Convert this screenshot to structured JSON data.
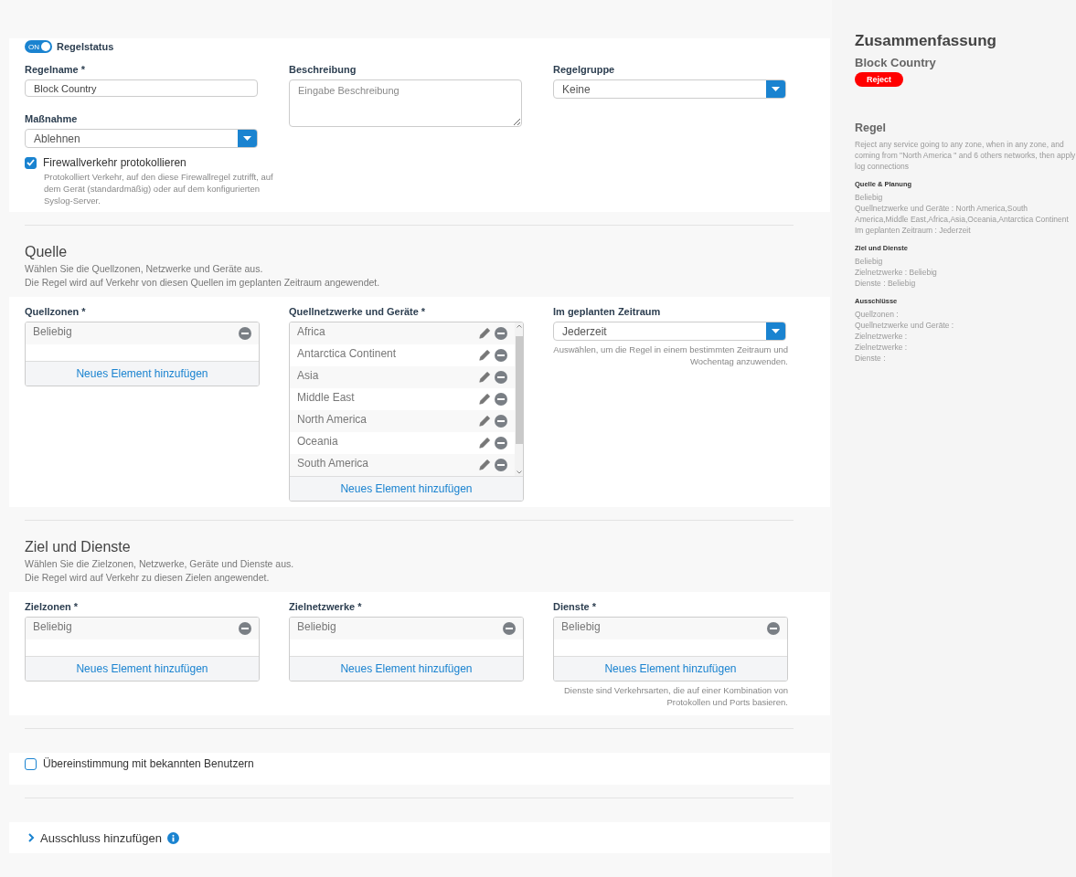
{
  "rule_status": {
    "toggle_text": "ON",
    "on": true,
    "label": "Regelstatus"
  },
  "rule_name": {
    "label": "Regelname *",
    "value": "Block Country"
  },
  "description": {
    "label": "Beschreibung",
    "placeholder": "Eingabe Beschreibung"
  },
  "rule_group": {
    "label": "Regelgruppe",
    "value": "Keine"
  },
  "action": {
    "label": "Maßnahme",
    "value": "Ablehnen"
  },
  "log_traffic": {
    "label": "Firewallverkehr protokollieren",
    "checked": true,
    "hint": "Protokolliert Verkehr, auf den diese Firewallregel zutrifft, auf dem Gerät (standardmäßig) oder auf dem konfigurierten Syslog-Server."
  },
  "source": {
    "title": "Quelle",
    "subtitle_lines": [
      "Wählen Sie die Quellzonen, Netzwerke und Geräte aus.",
      "Die Regel wird auf Verkehr von diesen Quellen im geplanten Zeitraum angewendet."
    ],
    "zones": {
      "label": "Quellzonen *",
      "items": [
        "Beliebig"
      ],
      "add": "Neues Element hinzufügen"
    },
    "networks": {
      "label": "Quellnetzwerke und Geräte *",
      "items": [
        "Africa",
        "Antarctica Continent",
        "Asia",
        "Middle East",
        "North America",
        "Oceania",
        "South America"
      ],
      "add": "Neues Element hinzufügen"
    },
    "schedule": {
      "label": "Im geplanten Zeitraum",
      "value": "Jederzeit",
      "hint": "Auswählen, um die Regel in einem bestimmten Zeitraum und Wochentag anzuwenden."
    }
  },
  "destination": {
    "title": "Ziel und Dienste",
    "subtitle_lines": [
      "Wählen Sie die Zielzonen, Netzwerke, Geräte und Dienste aus.",
      "Die Regel wird auf Verkehr zu diesen Zielen angewendet."
    ],
    "zones": {
      "label": "Zielzonen *",
      "items": [
        "Beliebig"
      ],
      "add": "Neues Element hinzufügen"
    },
    "networks": {
      "label": "Zielnetzwerke *",
      "items": [
        "Beliebig"
      ],
      "add": "Neues Element hinzufügen"
    },
    "services": {
      "label": "Dienste *",
      "items": [
        "Beliebig"
      ],
      "add": "Neues Element hinzufügen",
      "hint": "Dienste sind Verkehrsarten, die auf einer Kombination von Protokollen und Ports basieren."
    }
  },
  "match_users": {
    "label": "Übereinstimmung mit bekannten Benutzern",
    "checked": false
  },
  "exclusion": {
    "label": "Ausschluss hinzufügen",
    "expanded": false
  },
  "summary": {
    "title": "Zusammenfassung",
    "rule_name": "Block Country",
    "action_badge": "Reject",
    "rule_heading": "Regel",
    "rule_text": "Reject any service going to any zone, when in any zone, and coming from \"North America \" and 6 others networks, then apply log connections",
    "sections": [
      {
        "heading": "Quelle & Planung",
        "lines": [
          "Beliebig",
          "Quellnetzwerke und Geräte : North America,South America,Middle East,Africa,Asia,Oceania,Antarctica Continent",
          "Im geplanten Zeitraum : Jederzeit"
        ]
      },
      {
        "heading": "Ziel und Dienste",
        "lines": [
          "Beliebig",
          "Zielnetzwerke : Beliebig",
          "Dienste : Beliebig"
        ]
      },
      {
        "heading": "Ausschlüsse",
        "lines": [
          "Quellzonen :",
          "Quellnetzwerke und Geräte :",
          "Zielnetzwerke :",
          "Zielnetzwerke :",
          "Dienste :"
        ]
      }
    ]
  }
}
